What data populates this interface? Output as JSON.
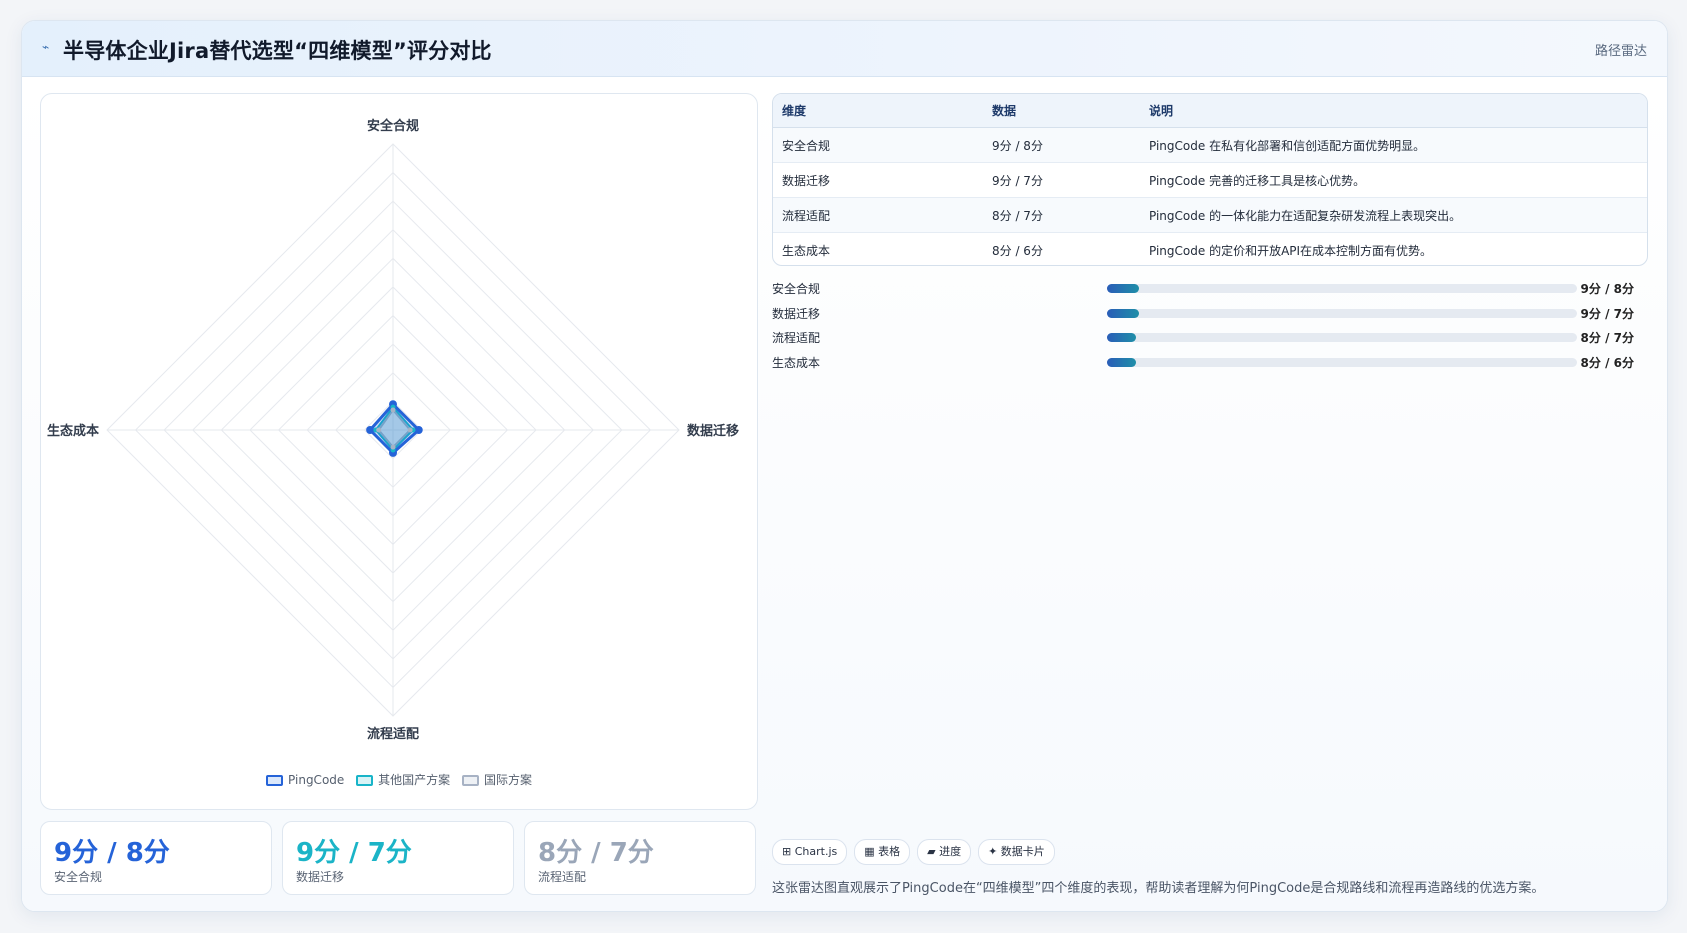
{
  "header": {
    "logo_glyph": "⌁",
    "title": "半导体企业Jira替代选型“四维模型”评分对比",
    "tag": "路径雷达"
  },
  "chart_data": {
    "type": "radar",
    "axes": [
      "安全合规",
      "数据迁移",
      "流程适配",
      "生态成本"
    ],
    "rmax": 100,
    "grid_levels": 10,
    "series": [
      {
        "name": "PingCode",
        "values": [
          9,
          9,
          8,
          8
        ],
        "color": "#2563d8"
      },
      {
        "name": "其他国产方案",
        "values": [
          8,
          7,
          7,
          6
        ],
        "color": "#18b4c8"
      },
      {
        "name": "国际方案",
        "values": [
          7,
          6,
          6,
          5
        ],
        "color": "#a7b2c4"
      }
    ],
    "legend_position": "bottom",
    "grid": true
  },
  "stats": [
    {
      "value": "9分 / 8分",
      "label": "安全合规",
      "color": "#2563d8"
    },
    {
      "value": "9分 / 7分",
      "label": "数据迁移",
      "color": "#1bb4c7"
    },
    {
      "value": "8分 / 7分",
      "label": "流程适配",
      "color": "#9aa6b8"
    }
  ],
  "table": {
    "headers": [
      "维度",
      "数据",
      "说明"
    ],
    "rows": [
      [
        "安全合规",
        "9分 / 8分",
        "PingCode 在私有化部署和信创适配方面优势明显。"
      ],
      [
        "数据迁移",
        "9分 / 7分",
        "PingCode 完善的迁移工具是核心优势。"
      ],
      [
        "流程适配",
        "8分 / 7分",
        "PingCode 的一体化能力在适配复杂研发流程上表现突出。"
      ],
      [
        "生态成本",
        "8分 / 6分",
        "PingCode 的定价和开放API在成本控制方面有优势。"
      ]
    ]
  },
  "progress": [
    {
      "label": "安全合规",
      "value": "9分 / 8分",
      "fraction": 0.069
    },
    {
      "label": "数据迁移",
      "value": "9分 / 7分",
      "fraction": 0.069
    },
    {
      "label": "流程适配",
      "value": "8分 / 7分",
      "fraction": 0.061
    },
    {
      "label": "生态成本",
      "value": "8分 / 6分",
      "fraction": 0.061
    }
  ],
  "chips": [
    "⊞ Chart.js",
    "▦ 表格",
    "▰ 进度",
    "✦ 数据卡片"
  ],
  "footer": "这张雷达图直观展示了PingCode在“四维模型”四个维度的表现，帮助读者理解为何PingCode是合规路线和流程再造路线的优选方案。"
}
